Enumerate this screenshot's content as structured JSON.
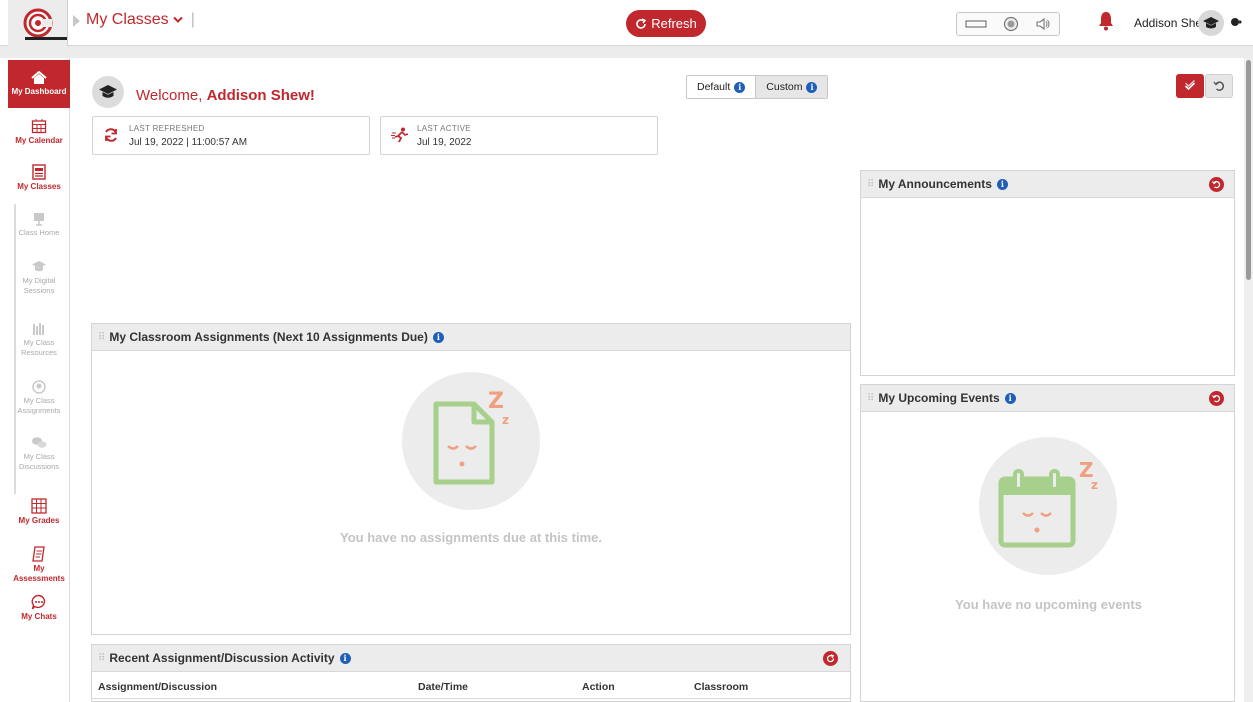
{
  "topbar": {
    "nav_title": "My Classes",
    "refresh_label": "Refresh",
    "user_name": "Addison Shew"
  },
  "sidebar": {
    "items": [
      {
        "label": "My Dashboard",
        "icon": "home-icon"
      },
      {
        "label": "My Calendar",
        "icon": "calendar-icon"
      },
      {
        "label": "My Classes",
        "icon": "classes-icon"
      },
      {
        "label": "Class Home",
        "icon": "class-home-icon"
      },
      {
        "label": "My Digital Sessions",
        "icon": "digital-sessions-icon"
      },
      {
        "label": "My Class Resources",
        "icon": "resources-icon"
      },
      {
        "label": "My Class Assignments",
        "icon": "assignments-icon"
      },
      {
        "label": "My Class Discussions",
        "icon": "discussions-icon"
      },
      {
        "label": "My Grades",
        "icon": "grades-icon"
      },
      {
        "label": "My Assessments",
        "icon": "assessments-icon"
      },
      {
        "label": "My Chats",
        "icon": "chats-icon"
      }
    ]
  },
  "welcome": {
    "prefix": "Welcome, ",
    "name": "Addison Shew!"
  },
  "layout_toggle": {
    "default_label": "Default",
    "custom_label": "Custom"
  },
  "stats": {
    "last_refreshed_caption": "LAST REFRESHED",
    "last_refreshed_value": "Jul 19, 2022 | 11:00:57 AM",
    "last_active_caption": "LAST ACTIVE",
    "last_active_value": "Jul 19, 2022"
  },
  "panels": {
    "announcements_title": "My Announcements",
    "upcoming_title": "My Upcoming Events",
    "upcoming_empty": "You have no upcoming events",
    "assignments_title": "My Classroom Assignments (Next 10 Assignments Due)",
    "assignments_empty": "You have no assignments due at this time.",
    "recent_title": "Recent Assignment/Discussion Activity",
    "recent_columns": [
      "Assignment/Discussion",
      "Date/Time",
      "Action",
      "Classroom"
    ]
  },
  "colors": {
    "brand_red": "#c0282d",
    "info_blue": "#1f5fb8",
    "empty_green": "#a8d08d",
    "empty_orange": "#f0a080"
  }
}
